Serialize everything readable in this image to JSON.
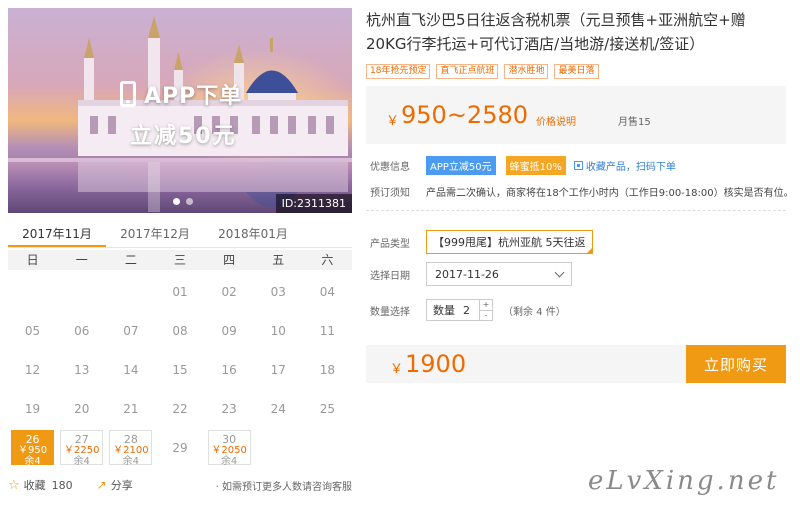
{
  "hero": {
    "promo_line1": "APP下单",
    "promo_line2": "立减50元",
    "image_id": "ID:2311381"
  },
  "calendar": {
    "months": [
      "2017年11月",
      "2017年12月",
      "2018年01月"
    ],
    "active_month": 0,
    "weekdays": [
      "日",
      "一",
      "二",
      "三",
      "四",
      "五",
      "六"
    ],
    "lead_blanks": 3,
    "days": [
      {
        "d": "01"
      },
      {
        "d": "02"
      },
      {
        "d": "03"
      },
      {
        "d": "04"
      },
      {
        "d": "05"
      },
      {
        "d": "06"
      },
      {
        "d": "07"
      },
      {
        "d": "08"
      },
      {
        "d": "09"
      },
      {
        "d": "10"
      },
      {
        "d": "11"
      },
      {
        "d": "12"
      },
      {
        "d": "13"
      },
      {
        "d": "14"
      },
      {
        "d": "15"
      },
      {
        "d": "16"
      },
      {
        "d": "17"
      },
      {
        "d": "18"
      },
      {
        "d": "19"
      },
      {
        "d": "20"
      },
      {
        "d": "21"
      },
      {
        "d": "22"
      },
      {
        "d": "23"
      },
      {
        "d": "24"
      },
      {
        "d": "25"
      },
      {
        "d": "26",
        "price": "￥950",
        "remain": "余4",
        "selected": true
      },
      {
        "d": "27",
        "price": "￥2250",
        "remain": "余4"
      },
      {
        "d": "28",
        "price": "￥2100",
        "remain": "余4"
      },
      {
        "d": "29"
      },
      {
        "d": "30",
        "price": "￥2050",
        "remain": "余4"
      }
    ]
  },
  "footer": {
    "favorite_label": "收藏",
    "favorite_count": "180",
    "share_label": "分享",
    "note": "· 如需预订更多人数请咨询客服"
  },
  "product": {
    "title": "杭州直飞沙巴5日往返含税机票（元旦预售+亚洲航空+赠20KG行李托运+可代订酒店/当地游/接送机/签证）",
    "tags": [
      "18年抢先预定",
      "直飞正点航班",
      "潜水胜地",
      "最美日落"
    ],
    "price_symbol": "￥",
    "price_range": "950~2580",
    "price_explain": "价格说明",
    "monthly_sales": "月售15"
  },
  "offers": {
    "label": "优惠信息",
    "app_badge": "APP立减50元",
    "bee_badge": "蜂蜜抵10%",
    "collect_link": "收藏产品，扫码下单"
  },
  "booking_notice": {
    "label": "预订须知",
    "text": "产品需二次确认，商家将在18个工作小时内（工作日9:00-18:00）核实是否有位。"
  },
  "form": {
    "type_label": "产品类型",
    "type_value": "【999甩尾】杭州亚航 5天往返",
    "date_label": "选择日期",
    "date_value": "2017-11-26",
    "qty_label": "数量选择",
    "qty_field_label": "数量",
    "qty_value": "2",
    "plus": "+",
    "minus": "-",
    "remain_text": "（剩余 4 件）"
  },
  "total": {
    "symbol": "￥",
    "amount": "1900",
    "buy_label": "立即购买"
  },
  "watermark": "eLvXing.net",
  "colors": {
    "accent": "#f09a14",
    "price": "#f06a00",
    "blue": "#4b9cf0"
  }
}
